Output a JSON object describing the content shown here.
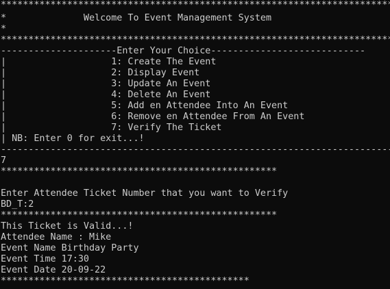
{
  "window": {
    "background": "#0c0c0c",
    "foreground": "#cccccc"
  },
  "console": {
    "lines": [
      "**************************************************************************",
      "*              Welcome To Event Management System                        *",
      "*                                                                        *",
      "**************************************************************************",
      "---------------------Enter Your Choice----------------------------",
      "|                   1: Create The Event                                  |",
      "|                   2: Display Event                                     |",
      "|                   3: Update An Event                                   |",
      "|                   4: Delete An Event                                   |",
      "|                   5: Add en Attendee Into An Event                     |",
      "|                   6: Remove en Attendee From An Event                  |",
      "|                   7: Verify The Ticket                                 |",
      "| NB: Enter 0 for exit...!                                               |",
      "-------------------------------------------------------------------------",
      "7",
      "**************************************************",
      "",
      "Enter Attendee Ticket Number that you want to Verify",
      "BD_T:2",
      "**************************************************",
      "This Ticket is Valid...!",
      "Attendee Name : Mike",
      "Event Name Birthday Party",
      "Event Time 17:30",
      "Event Date 20-09-22",
      "*********************************************"
    ]
  }
}
